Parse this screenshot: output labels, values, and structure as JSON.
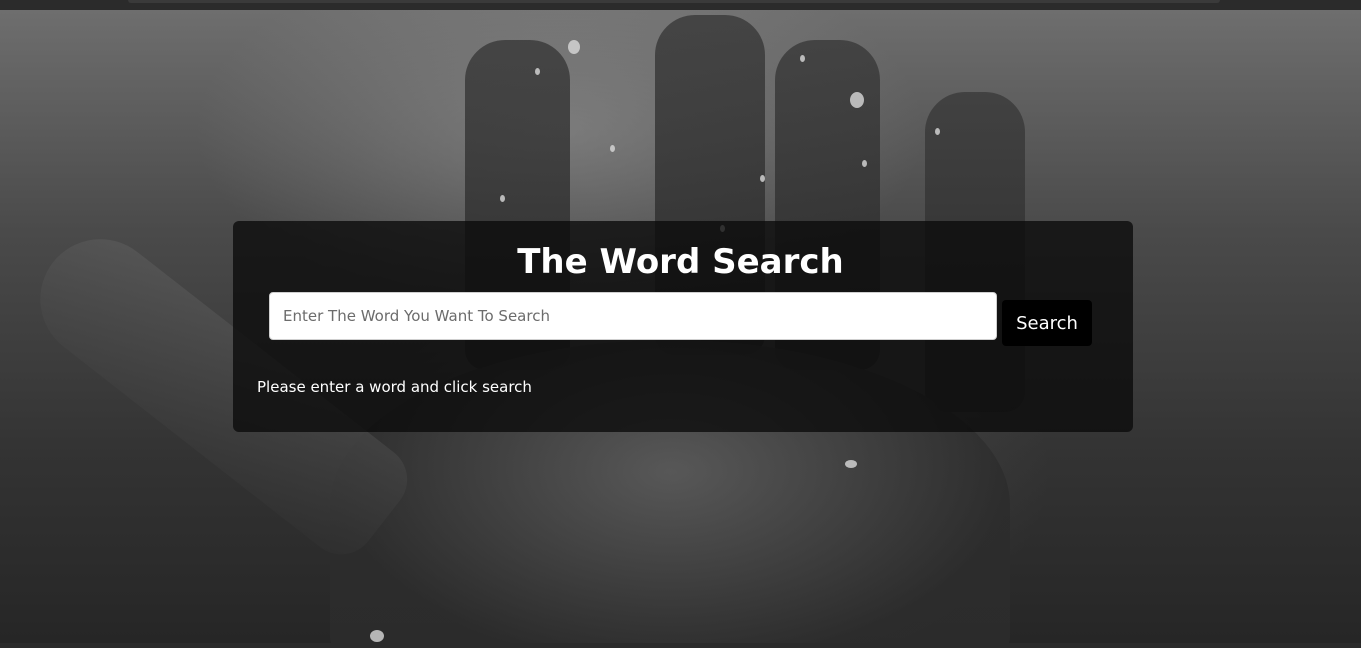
{
  "app": {
    "title": "The Word Search"
  },
  "search": {
    "placeholder": "Enter The Word You Want To Search",
    "value": "",
    "button_label": "Search"
  },
  "status": {
    "message": "Please enter a word and click search"
  },
  "colors": {
    "panel_background": "#0a0a0a",
    "button_background": "#000000",
    "text": "#ffffff"
  }
}
